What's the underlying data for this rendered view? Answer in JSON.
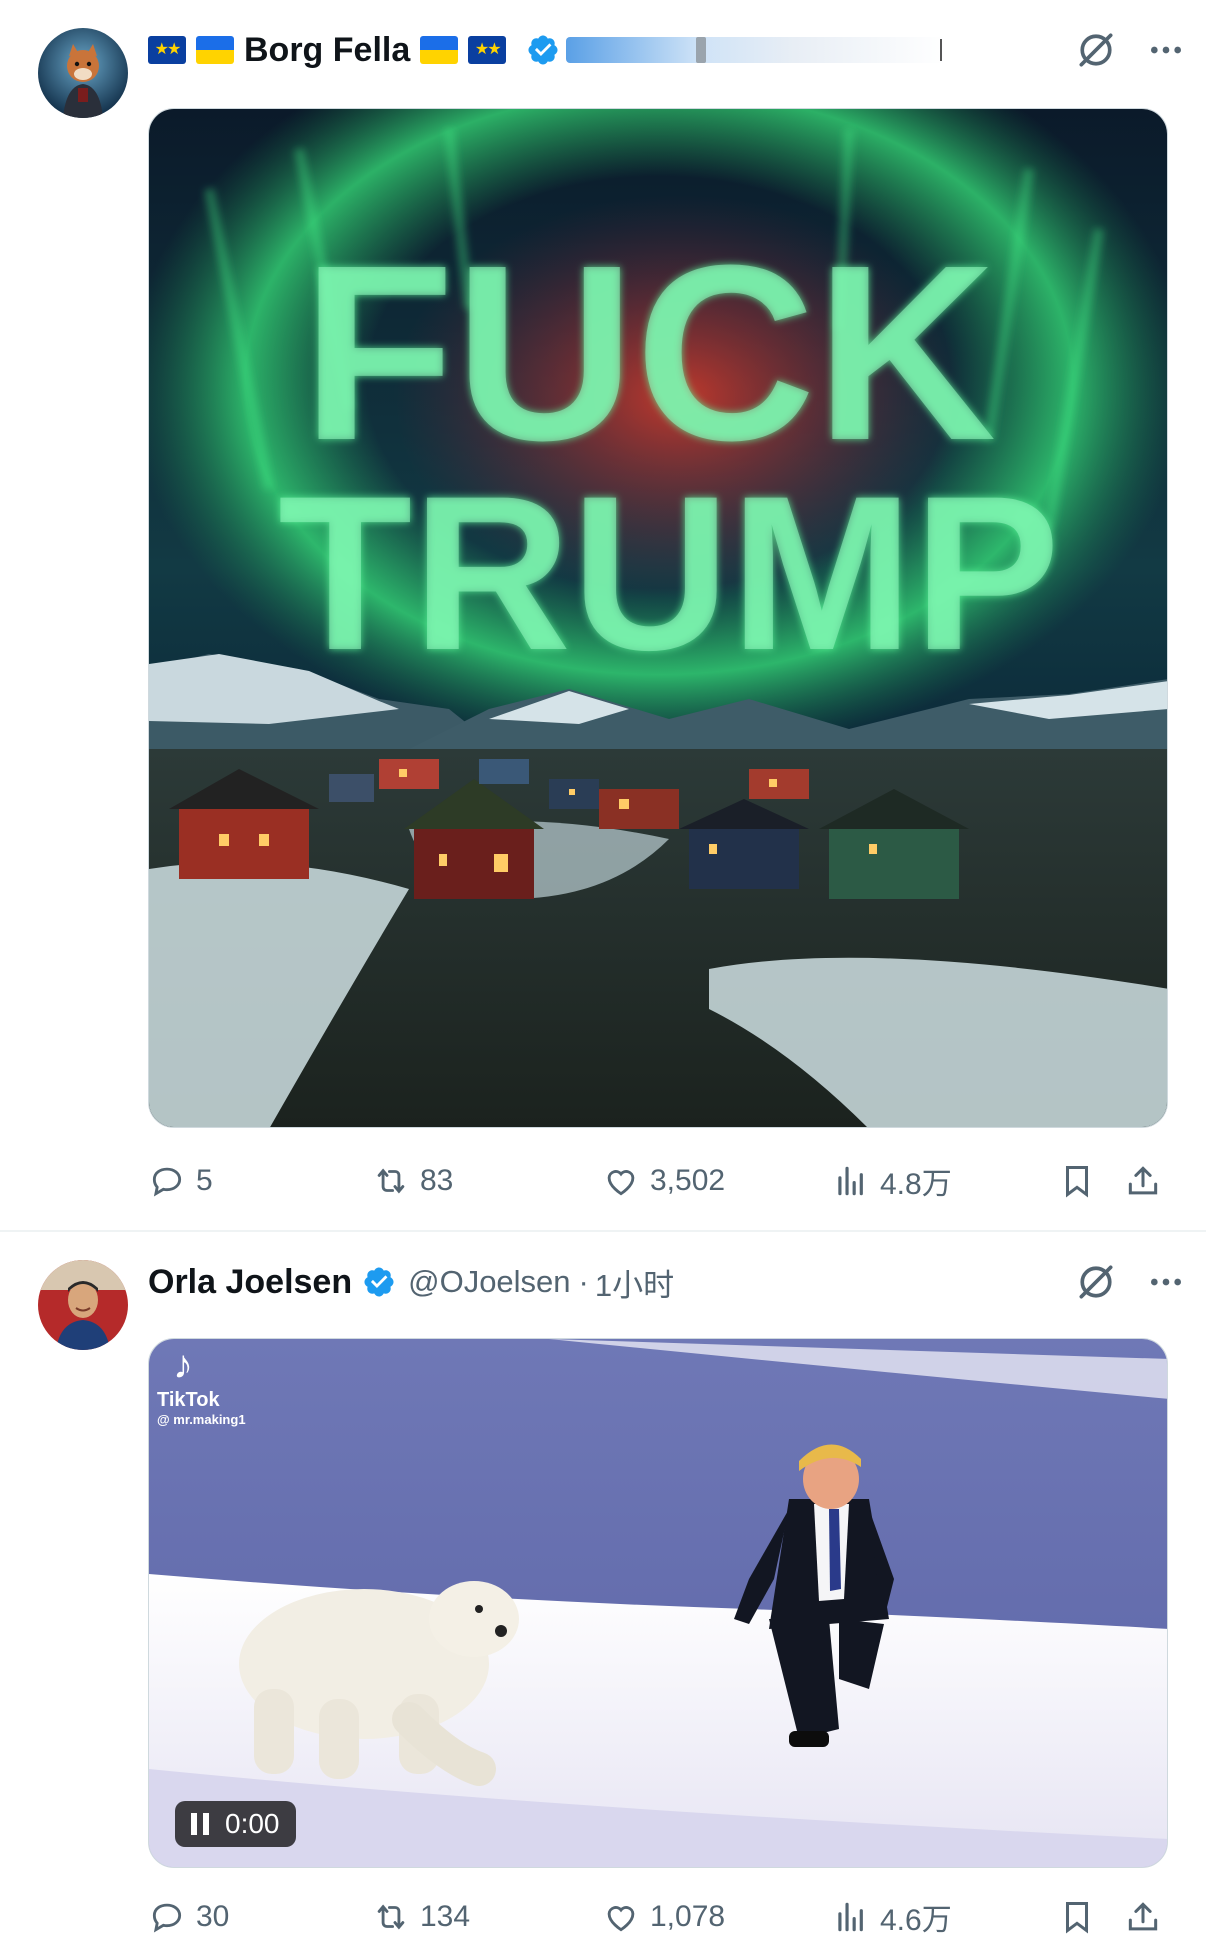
{
  "posts": [
    {
      "author": {
        "display_name": "Borg Fella",
        "avatar_icon": "fox-knight-avatar",
        "flags": [
          "eu",
          "ua",
          "ua",
          "eu"
        ],
        "verified": true
      },
      "media": {
        "type": "image",
        "overlay_text_line1": "FUCK",
        "overlay_text_line2": "TRUMP"
      },
      "stats": {
        "replies": "5",
        "reposts": "83",
        "likes": "3,502",
        "views": "4.8万"
      }
    },
    {
      "author": {
        "display_name": "Orla Joelsen",
        "handle": "@OJoelsen",
        "separator": "·",
        "time": "1小时",
        "avatar_icon": "man-portrait-avatar",
        "verified": true
      },
      "media": {
        "type": "video",
        "watermark_brand": "TikTok",
        "watermark_user": "@ mr.making1",
        "time": "0:00"
      },
      "stats": {
        "replies": "30",
        "reposts": "134",
        "likes": "1,078",
        "views": "4.6万"
      }
    }
  ],
  "colors": {
    "verified": "#1d9bf0",
    "muted": "#536471",
    "text": "#0f1419",
    "divider": "#eff3f4"
  }
}
